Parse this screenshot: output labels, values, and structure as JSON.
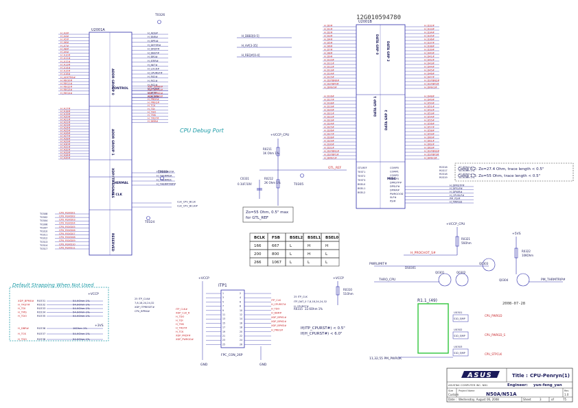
{
  "doc_id": "12G010594780",
  "cpu_left": {
    "ref": "U2001A",
    "left_pins": [
      "H_A3#",
      "H_A4#",
      "H_A5#",
      "H_A6#",
      "H_A7#",
      "H_A8#",
      "H_A9#",
      "H_A10#",
      "H_A11#",
      "H_A12#",
      "H_A13#",
      "H_A14#",
      "H_A15#",
      "H_A16#",
      "H_ADSTB0#",
      "H_REQ0#",
      "H_REQ1#",
      "H_REQ2#",
      "H_REQ3#",
      "H_REQ4#"
    ],
    "left_pins_b": [
      "H_A17#",
      "H_A18#",
      "H_A19#",
      "H_A20#",
      "H_A21#",
      "H_A22#",
      "H_A23#",
      "H_A24#",
      "H_A25#",
      "H_A26#",
      "H_A27#",
      "H_A28#",
      "H_A29#",
      "H_A30#",
      "H_A31#",
      "H_A32#",
      "H_A33#",
      "H_A34#",
      "H_A35#"
    ],
    "groups": [
      "ADDR GROUP 0",
      "CONTROL",
      "ADDR GROUP 1",
      "XDP/ITP SIGNALS",
      "THERMAL",
      "H CLK",
      "RESERVED"
    ],
    "right_pins": [
      "H_ADS#",
      "H_BNR#",
      "H_BPRI#",
      "H_DEFER#",
      "H_DRDY#",
      "H_DBSY#",
      "H_BR0#",
      "H_IERR#",
      "H_INIT#",
      "H_LOCK#",
      "H_CPURST#",
      "H_RS0#",
      "H_RS1#",
      "H_RS2#",
      "H_TRDY#",
      "H_HIT#",
      "H_HITM#",
      "XDP_BPM0#",
      "XDP_BPM1#",
      "XDP_BPM2#",
      "XDP_BPM3#",
      "H_PRDY#",
      "H_PREQ#",
      "H_TCK",
      "H_TDI",
      "H_TDO",
      "H_TMS",
      "H_TRST#",
      "H_DBR#"
    ]
  },
  "debug_port_title": "CPU Debug Port",
  "ids": {
    "thermal_left": [
      "H_PROCHOT#",
      "H_THERMDA",
      "H_THERMDC",
      "H_THERMTRIP#"
    ],
    "clk": [
      "CLK_CPU_BCLK",
      "CLK_CPU_BCLK#"
    ],
    "test_points": [
      "T0326",
      "T0309",
      "T0324",
      "T0305"
    ],
    "reserved_labels": [
      "CPU_RSVD01",
      "CPU_RSVD02",
      "CPU_RSVD03",
      "CPU_RSVD04",
      "CPU_RSVD05",
      "CPU_RSVD06",
      "CPU_RSVD07",
      "CPU_RSVD08",
      "CPU_RSVD09",
      "CPU_RSVD10",
      "CPU_RSVD11"
    ],
    "reserved_tps": [
      "T0308",
      "T0302",
      "T0304",
      "T0306",
      "T0307",
      "T0310",
      "T0311",
      "T0312",
      "T0313",
      "T0314",
      "T0317"
    ]
  },
  "mid": {
    "signals": [
      "H_DBE0[0-5]",
      "H_A#[3-35]",
      "H_REQ#[0-4]"
    ],
    "gtl_label": "GTL_REF",
    "vcc": "+VCCP_CPU",
    "r_main": "R0211",
    "r_val": "1K Ohm 1%",
    "c_main": "C0331",
    "c_val": "0.1UF/10V",
    "r2": "R0212",
    "r2_val": "2K Ohm 1%"
  },
  "zo_box": [
    "Zo=55 Ohm, 0.5\" max",
    "for GTL_REF"
  ],
  "bsel_table": {
    "headers": [
      "BCLK",
      "FSB",
      "BSEL2",
      "BSEL1",
      "BSEL0"
    ],
    "rows": [
      [
        "166",
        "667",
        "L",
        "H",
        "H"
      ],
      [
        "200",
        "800",
        "L",
        "H",
        "L"
      ],
      [
        "266",
        "1067",
        "L",
        "L",
        "L"
      ]
    ]
  },
  "cpu_right": {
    "ref": "U2001B",
    "groups": [
      "DATA GRP 0",
      "DATA GRP 1",
      "DATA GRP 2",
      "DATA GRP 3",
      "MISC"
    ],
    "data_left": [
      "H_D0#",
      "H_D1#",
      "H_D2#",
      "H_D3#",
      "H_D4#",
      "H_D5#",
      "H_D6#",
      "H_D7#",
      "H_D8#",
      "H_D9#",
      "H_D10#",
      "H_D11#",
      "H_D12#",
      "H_D13#",
      "H_D14#",
      "H_D15#",
      "H_DSTBN0#",
      "H_DSTBP0#",
      "H_DINV0#"
    ],
    "data_left_b": [
      "H_D16#",
      "H_D17#",
      "H_D18#",
      "H_D19#",
      "H_D20#",
      "H_D21#",
      "H_D22#",
      "H_D23#",
      "H_D24#",
      "H_D25#",
      "H_D26#",
      "H_D27#",
      "H_D28#",
      "H_D29#",
      "H_D30#",
      "H_D31#",
      "H_DSTBN1#",
      "H_DSTBP1#",
      "H_DINV1#"
    ],
    "data_right": [
      "H_D32#",
      "H_D33#",
      "H_D34#",
      "H_D35#",
      "H_D36#",
      "H_D37#",
      "H_D38#",
      "H_D39#",
      "H_D40#",
      "H_D41#",
      "H_D42#",
      "H_D43#",
      "H_D44#",
      "H_D45#",
      "H_D46#",
      "H_D47#",
      "H_DSTBN2#",
      "H_DSTBP2#",
      "H_DINV2#"
    ],
    "data_right_b": [
      "H_D48#",
      "H_D49#",
      "H_D50#",
      "H_D51#",
      "H_D52#",
      "H_D53#",
      "H_D54#",
      "H_D55#",
      "H_D56#",
      "H_D57#",
      "H_D58#",
      "H_D59#",
      "H_D60#",
      "H_D61#",
      "H_D62#",
      "H_D63#",
      "H_DSTBN3#",
      "H_DSTBP3#",
      "H_DINV3#"
    ],
    "misc_left": [
      "GTLREF",
      "TEST1",
      "TEST2",
      "TEST3",
      "BSEL0",
      "BSEL1",
      "BSEL2"
    ],
    "misc_right": [
      "COMP0",
      "COMP1",
      "COMP2",
      "COMP3",
      "DPRSTP#",
      "DPSLP#",
      "DPWR#",
      "PWRGOOD",
      "SLP#",
      "PSI#"
    ]
  },
  "comp_note": [
    "Comp 0,2: Zo=27.4 Ohm, trace length < 0.5\"",
    "Comp 1,3: Zo=55 Ohm, trace length < 0.5\""
  ],
  "comp_res": [
    [
      "R0316",
      "27.4Ohm 1%"
    ],
    [
      "R0317",
      "54.9Ohm 1%"
    ],
    [
      "R0318",
      "27.4Ohm 1%"
    ],
    [
      "R0319",
      "54.9Ohm 1%"
    ]
  ],
  "misc_sigs": [
    "H_DPRSTP#",
    "H_DPSLP#",
    "H_DPWR#",
    "H_CPUSLP#",
    "PM_PSI#",
    "H_PWRGD"
  ],
  "right_bottom": {
    "vcc1": "+VCCP_CPU",
    "r1": "R0321",
    "r1v": "56Ohm",
    "sig1": "H_PROCHOT_S#",
    "vcc2": "+5VS",
    "r2": "R0322",
    "r2v": "10KOhm",
    "q1": "Q0301",
    "q2": "Q0302",
    "q3": "Q0303",
    "q4": "Q0304",
    "ds": "DS0301",
    "pwr": "PWRLIMIT#",
    "therm": "THRO_CPU",
    "pm": "PM_THRMTRIP#",
    "date": "2008-07-28",
    "r1_49": "R1.1_(49)",
    "parts": [
      [
        "U0301",
        "S1D_EJMP"
      ],
      [
        "U0302",
        "S1D_EJMP"
      ],
      [
        "U0303",
        "S1D_EJMP"
      ]
    ],
    "sigs": [
      "CPU_PWRGD",
      "CPU_PWRGD_S",
      "CPU_STPCLK"
    ],
    "bottom_sig": "11,32,55  PM_PWROK"
  },
  "strap": {
    "title": "Default Strapping When Not Used",
    "vcc": "+VCCP",
    "vcc2": "+3VS",
    "rows": [
      [
        "XDP_BPM0#",
        "R0331",
        "54.9Ohm 1%"
      ],
      [
        "H_TRST#",
        "R0332",
        "54.9Ohm 1%"
      ],
      [
        "H_TDI",
        "R0333",
        "54.9Ohm 1%"
      ],
      [
        "H_TMS",
        "R0334",
        "54.9Ohm 1%"
      ],
      [
        "H_TDO",
        "R0335",
        "54.9Ohm 1%"
      ],
      [
        "H_DBR#",
        "R0336",
        "1KOhm 1%"
      ],
      [
        "H_TCK",
        "R0337",
        "54.9Ohm 1%"
      ],
      [
        "H_TDO",
        "R0338",
        "54.9Ohm 1%"
      ]
    ]
  },
  "itp": {
    "title": "ITP1",
    "subtitle": "FPC_CON_26P",
    "vcc": "+VCCP",
    "left_pins": [
      "ITP_CLK#",
      "XDP_CLK_R",
      "H_TDO",
      "H_TDI",
      "H_TMS",
      "H_TRST#",
      "H_TCK",
      "XDP_PRDY#",
      "XDP_PWRGD#"
    ],
    "left_nets": [
      "25  ITP_CLK#",
      "7,8,18,24,24,32",
      "XDP_ITPRESET#",
      "CPU_BPM4#"
    ],
    "right_pins": [
      "ITP_CLK",
      "H_CPURST#",
      "H_TDO",
      "H_DBR#",
      "XDP_BPM1#",
      "XDP_BPM2#",
      "XDP_BPM3#",
      "H_PREQ#"
    ],
    "right_nets": [
      "25  ITP_CLK",
      "ITP_DAT_0  7,8,18,24,24,32",
      "H_CPURST#"
    ],
    "r": "R0310",
    "rv": "51Ohm",
    "vcc_r": "+VCCP",
    "gnd": [
      "GND",
      "GND"
    ],
    "note": [
      "If(ITP_CPURST#) < 0.5\"",
      "If(H_CPURST#) < 6.0\""
    ],
    "r2": "R0315",
    "r2v": "22.6Ohm 1%"
  },
  "title_block": {
    "company": "ASUSTeK COMPUTER INC. NB1",
    "title_label": "Title :",
    "title": "CPU-Penryn(1)",
    "engineer_label": "Engineer:",
    "engineer": "yun-feng_yan",
    "size_label": "Size",
    "size": "Custom",
    "project_label": "Project Name",
    "project": "N50A/N51A",
    "rev_label": "Rev",
    "rev": "1.0",
    "date_label": "Date :",
    "date": "Wednesday, August 06, 2008",
    "sheet_label": "Sheet",
    "sheet": "3",
    "of_label": "of",
    "of": "75",
    "logo": "ASUS"
  },
  "colors": {
    "line": "#2a2aa8",
    "net": "#c8252b",
    "label": "#1a1a5a",
    "teal": "#1a9aa6",
    "green": "#2ec43a"
  }
}
